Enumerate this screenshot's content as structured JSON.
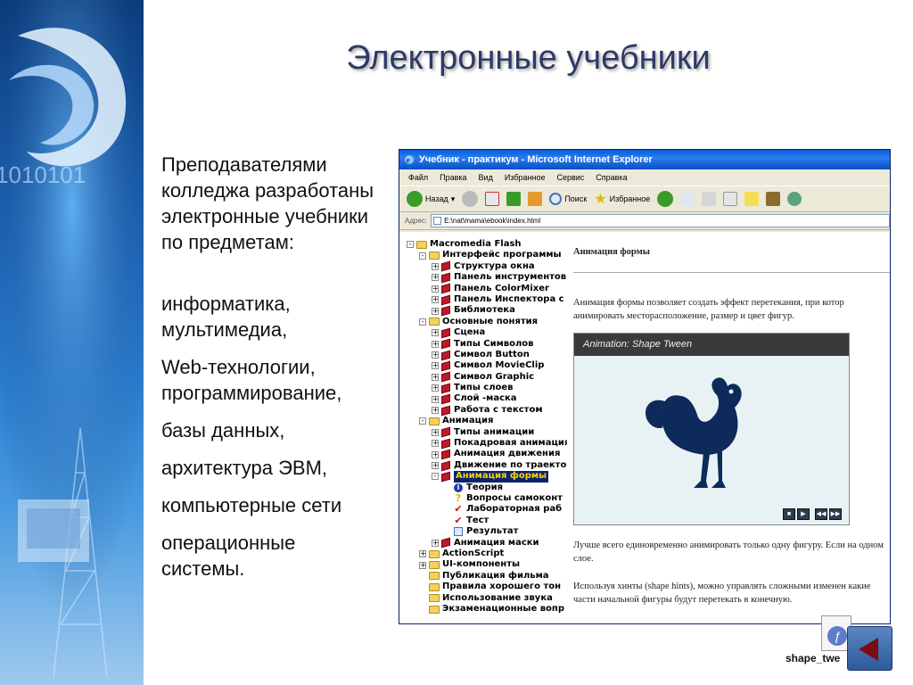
{
  "slide": {
    "title": "Электронные учебники",
    "intro": [
      "Преподавателями",
      "колледжа разработаны",
      "электронные учебники",
      "по предметам:"
    ],
    "subjects": [
      "информатика,",
      "мультимедиа,",
      "Web-технологии,",
      "программирование,",
      "базы данных,",
      "архитектура ЭВМ,",
      "компьютерные сети",
      "операционные",
      "системы."
    ]
  },
  "browser": {
    "title": "Учебник - практикум - Microsoft Internet Explorer",
    "menu": [
      "Файл",
      "Правка",
      "Вид",
      "Избранное",
      "Сервис",
      "Справка"
    ],
    "toolbar": {
      "back": "Назад",
      "search": "Поиск",
      "favorites": "Избранное"
    },
    "address_label": "Адрес:",
    "address": "E:\\nat\\mama\\ebook\\index.html",
    "tree": [
      {
        "level": 0,
        "icon": "folder",
        "exp": "-",
        "label": "Macromedia Flash"
      },
      {
        "level": 1,
        "icon": "folder",
        "exp": "-",
        "label": "Интерфейс программы"
      },
      {
        "level": 2,
        "icon": "book",
        "exp": "+",
        "label": "Структура окна"
      },
      {
        "level": 2,
        "icon": "book",
        "exp": "+",
        "label": "Панель инструментов"
      },
      {
        "level": 2,
        "icon": "book",
        "exp": "+",
        "label": "Панель ColorMixer"
      },
      {
        "level": 2,
        "icon": "book",
        "exp": "+",
        "label": "Панель Инспектора с"
      },
      {
        "level": 2,
        "icon": "book",
        "exp": "+",
        "label": "Библиотека"
      },
      {
        "level": 1,
        "icon": "folder",
        "exp": "-",
        "label": "Основные понятия"
      },
      {
        "level": 2,
        "icon": "book",
        "exp": "+",
        "label": "Сцена"
      },
      {
        "level": 2,
        "icon": "book",
        "exp": "+",
        "label": "Типы Символов"
      },
      {
        "level": 2,
        "icon": "book",
        "exp": "+",
        "label": "Символ Button"
      },
      {
        "level": 2,
        "icon": "book",
        "exp": "+",
        "label": "Символ MovieClip"
      },
      {
        "level": 2,
        "icon": "book",
        "exp": "+",
        "label": "Символ Graphic"
      },
      {
        "level": 2,
        "icon": "book",
        "exp": "+",
        "label": "Типы слоев"
      },
      {
        "level": 2,
        "icon": "book",
        "exp": "+",
        "label": "Слой -маска"
      },
      {
        "level": 2,
        "icon": "book",
        "exp": "+",
        "label": "Работа с текстом"
      },
      {
        "level": 1,
        "icon": "folder",
        "exp": "-",
        "label": "Анимация"
      },
      {
        "level": 2,
        "icon": "book",
        "exp": "+",
        "label": "Типы анимации"
      },
      {
        "level": 2,
        "icon": "book",
        "exp": "+",
        "label": "Покадровая анимация"
      },
      {
        "level": 2,
        "icon": "book",
        "exp": "+",
        "label": "Анимация движения"
      },
      {
        "level": 2,
        "icon": "book",
        "exp": "+",
        "label": "Движение по траекто"
      },
      {
        "level": 2,
        "icon": "book",
        "exp": "-",
        "label": "Анимация формы",
        "selected": true
      },
      {
        "level": 3,
        "icon": "info",
        "exp": "",
        "label": "Теория"
      },
      {
        "level": 3,
        "icon": "question",
        "exp": "",
        "label": "Вопросы самоконт"
      },
      {
        "level": 3,
        "icon": "check",
        "exp": "",
        "label": "Лабораторная раб"
      },
      {
        "level": 3,
        "icon": "check",
        "exp": "",
        "label": "Тест"
      },
      {
        "level": 3,
        "icon": "page",
        "exp": "",
        "label": "Результат"
      },
      {
        "level": 2,
        "icon": "book",
        "exp": "+",
        "label": "Анимация маски"
      },
      {
        "level": 1,
        "icon": "folder",
        "exp": "+",
        "label": "ActionScript"
      },
      {
        "level": 1,
        "icon": "folder",
        "exp": "+",
        "label": "UI-компоненты"
      },
      {
        "level": 1,
        "icon": "folder",
        "exp": "",
        "label": "Публикация фильма"
      },
      {
        "level": 1,
        "icon": "folder",
        "exp": "",
        "label": "Правила хорошего тон"
      },
      {
        "level": 1,
        "icon": "folder",
        "exp": "",
        "label": "Использование звука"
      },
      {
        "level": 1,
        "icon": "folder",
        "exp": "",
        "label": "Экзаменационные вопр"
      }
    ],
    "article": {
      "heading": "Анимация формы",
      "p1": "Анимация формы позволяет создать эффект перетекания, при котор анимировать месторасположение, размер и цвет фигур.",
      "flash_title": "Animation: Shape Tween",
      "p2": "Лучше всего единовременно анимировать только одну фигуру. Если на одном слое.",
      "p3": "Используя хинты (shape hints), можно управлять сложными изменен какие части начальной фигуры будут перетекать в конечную."
    }
  },
  "file_icon_label": "shape_twe",
  "colors": {
    "title": "#2d3a66",
    "ie_titlebar": "#0a5bd8",
    "tree_book": "#c0182a",
    "rooster": "#0e2a5a"
  }
}
